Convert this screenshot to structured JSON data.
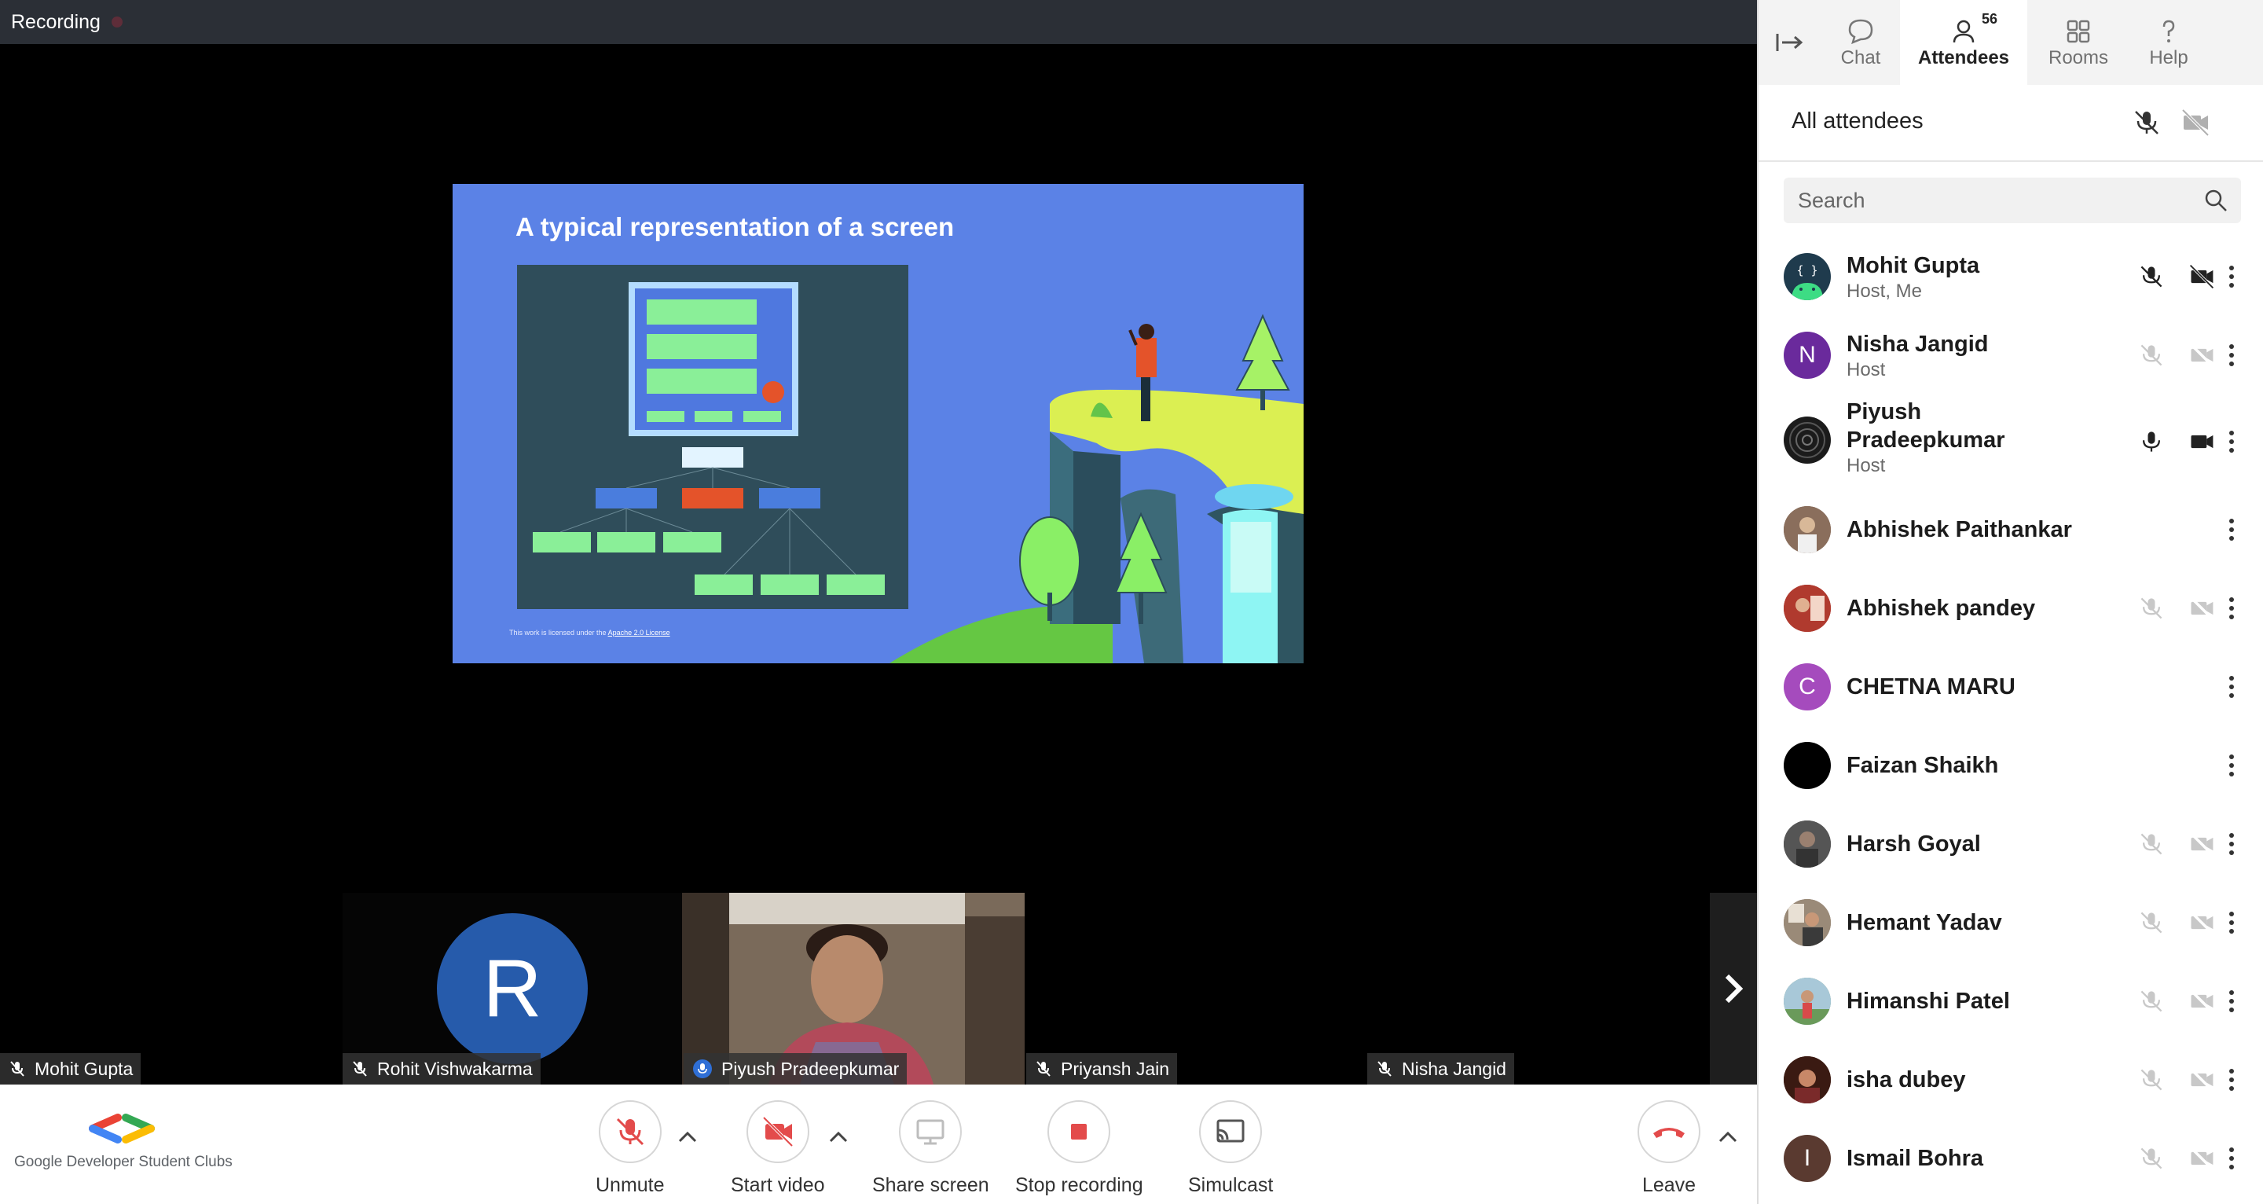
{
  "topbar": {
    "recording_label": "Recording"
  },
  "slide": {
    "title": "A typical representation of a screen",
    "footer_prefix": "This work is licensed under the ",
    "footer_link": "Apache 2.0 License"
  },
  "tiles": [
    {
      "name": "Mohit Gupta",
      "mic": "muted"
    },
    {
      "name": "Rohit Vishwakarma",
      "initial": "R",
      "mic": "muted"
    },
    {
      "name": "Piyush Pradeepkumar",
      "mic": "on"
    },
    {
      "name": "Priyansh Jain",
      "mic": "muted"
    },
    {
      "name": "Nisha Jangid",
      "mic": "muted"
    }
  ],
  "controls": {
    "logo_text": "Google Developer Student Clubs",
    "unmute": "Unmute",
    "start_video": "Start video",
    "share_screen": "Share screen",
    "stop_recording": "Stop recording",
    "simulcast": "Simulcast",
    "leave": "Leave"
  },
  "sidebar": {
    "tabs": {
      "chat": "Chat",
      "attendees": "Attendees",
      "attendee_count": "56",
      "rooms": "Rooms",
      "help": "Help"
    },
    "all_attendees": "All attendees",
    "search_placeholder": "Search",
    "attendees": [
      {
        "name": "Mohit Gupta",
        "role": "Host, Me",
        "avatar_color": "#1f3b4d"
      },
      {
        "name": "Nisha Jangid",
        "role": "Host",
        "initial": "N",
        "avatar_color": "#6a2a9c"
      },
      {
        "name_line1": "Piyush",
        "name_line2": "Pradeepkumar",
        "role": "Host",
        "avatar_color": "#1b1b1b"
      },
      {
        "name": "Abhishek Paithankar",
        "avatar_color": "#7b5c4c"
      },
      {
        "name": "Abhishek pandey",
        "avatar_color": "#a8322d"
      },
      {
        "name": "CHETNA MARU",
        "initial": "C",
        "avatar_color": "#a54bbd"
      },
      {
        "name": "Faizan Shaikh",
        "avatar_color": "#000000"
      },
      {
        "name": "Harsh Goyal",
        "avatar_color": "#4a4a4a"
      },
      {
        "name": "Hemant Yadav",
        "avatar_color": "#8a7a6a"
      },
      {
        "name": "Himanshi Patel",
        "avatar_color": "#5c8e6a"
      },
      {
        "name": "isha dubey",
        "avatar_color": "#5a2a1a"
      },
      {
        "name": "Ismail Bohra",
        "initial": "I",
        "avatar_color": "#5a3a30"
      }
    ]
  },
  "colors": {
    "slide_bg": "#5b82e6",
    "accent_red": "#e34b4b",
    "avatar_blue": "#265bab"
  }
}
